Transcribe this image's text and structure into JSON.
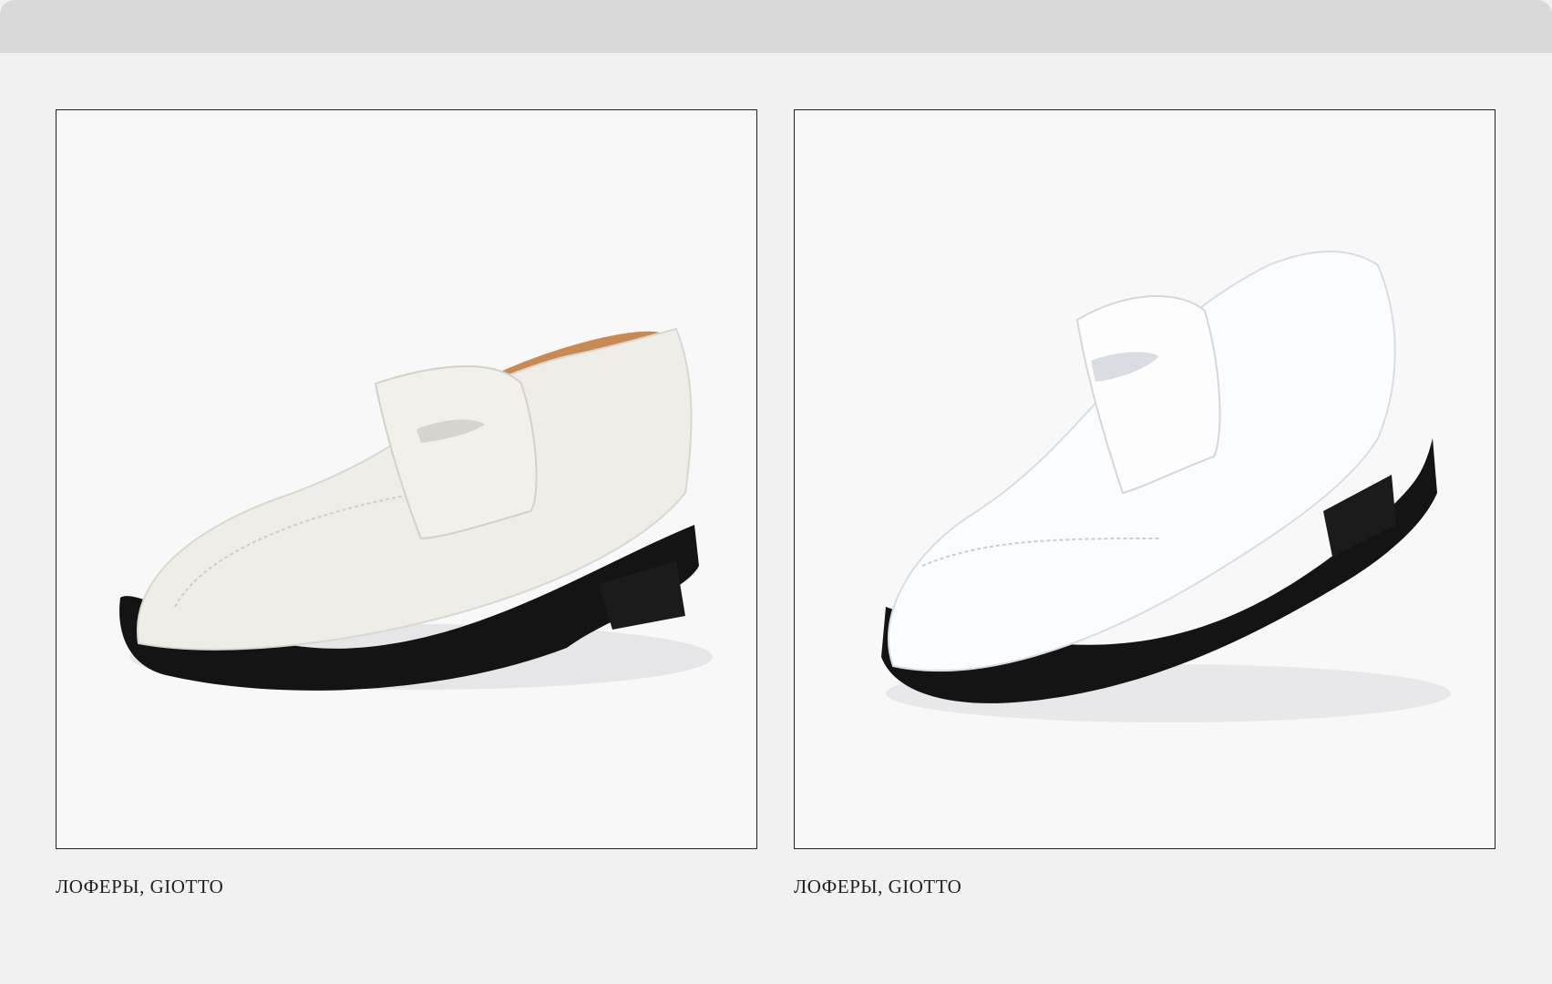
{
  "products": [
    {
      "caption": "ЛОФЕРЫ, GIOTTO",
      "image": "white-loafer-image",
      "colors": {
        "upper": "#eeede8",
        "sole": "#141414",
        "lining": "#c98a52"
      }
    },
    {
      "caption": "ЛОФЕРЫ, GIOTTO",
      "image": "glossy-white-loafer-image",
      "colors": {
        "upper": "#fbfcfe",
        "sole": "#141414",
        "lining": "#c98a52"
      }
    }
  ]
}
